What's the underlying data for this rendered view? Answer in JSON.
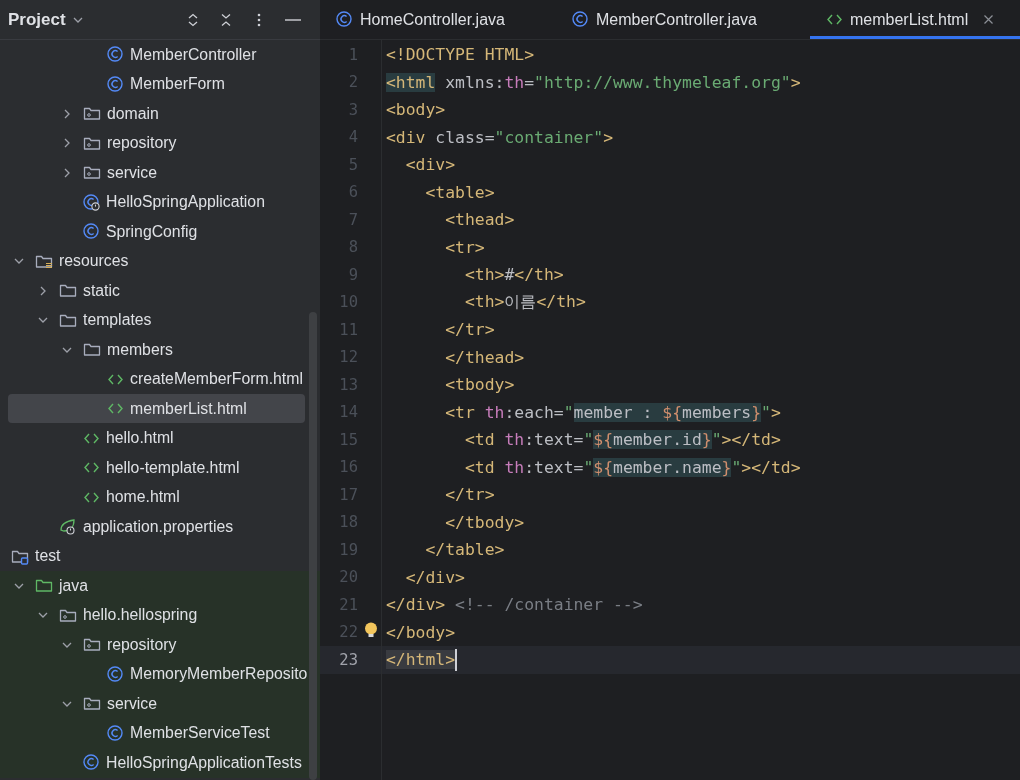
{
  "sidebar": {
    "title": "Project",
    "tree": [
      {
        "kind": "hidden",
        "children": [
          {
            "kind": "hidden",
            "children": [
              {
                "kind": "hidden",
                "children": [
                  {
                    "kind": "hidden",
                    "children": [
                      {
                        "kind": "class",
                        "label": "MemberController",
                        "selected": false
                      },
                      {
                        "kind": "class",
                        "label": "MemberForm",
                        "selected": false
                      }
                    ]
                  },
                  {
                    "kind": "package",
                    "label": "domain",
                    "expanded": false,
                    "selected": false
                  },
                  {
                    "kind": "package",
                    "label": "repository",
                    "expanded": false,
                    "selected": false
                  },
                  {
                    "kind": "package",
                    "label": "service",
                    "expanded": false,
                    "selected": false
                  },
                  {
                    "kind": "spring-app",
                    "label": "HelloSpringApplication",
                    "selected": false
                  },
                  {
                    "kind": "class",
                    "label": "SpringConfig",
                    "selected": false
                  }
                ]
              }
            ]
          },
          {
            "kind": "resources-folder",
            "label": "resources",
            "expanded": true,
            "selected": false,
            "children": [
              {
                "kind": "folder",
                "label": "static",
                "expanded": false,
                "selected": false
              },
              {
                "kind": "folder",
                "label": "templates",
                "expanded": true,
                "selected": false,
                "children": [
                  {
                    "kind": "folder",
                    "label": "members",
                    "expanded": true,
                    "selected": false,
                    "children": [
                      {
                        "kind": "html",
                        "label": "createMemberForm.html",
                        "selected": false
                      },
                      {
                        "kind": "html",
                        "label": "memberList.html",
                        "selected": true
                      }
                    ]
                  },
                  {
                    "kind": "html",
                    "label": "hello.html",
                    "selected": false
                  },
                  {
                    "kind": "html",
                    "label": "hello-template.html",
                    "selected": false
                  },
                  {
                    "kind": "html",
                    "label": "home.html",
                    "selected": false
                  }
                ]
              },
              {
                "kind": "properties",
                "label": "application.properties",
                "selected": false
              }
            ]
          }
        ]
      },
      {
        "kind": "test-folder",
        "label": "test",
        "selected": false,
        "children": [
          {
            "kind": "test-source-folder",
            "label": "java",
            "expanded": true,
            "selected": false,
            "children": [
              {
                "kind": "package",
                "label": "hello.hellospring",
                "expanded": true,
                "selected": false,
                "children": [
                  {
                    "kind": "package",
                    "label": "repository",
                    "expanded": true,
                    "selected": false,
                    "children": [
                      {
                        "kind": "class",
                        "label": "MemoryMemberReposito",
                        "selected": false
                      }
                    ]
                  },
                  {
                    "kind": "package",
                    "label": "service",
                    "expanded": true,
                    "selected": false,
                    "children": [
                      {
                        "kind": "class",
                        "label": "MemberServiceTest",
                        "selected": false
                      }
                    ]
                  },
                  {
                    "kind": "class",
                    "label": "HelloSpringApplicationTests",
                    "selected": false
                  }
                ]
              }
            ]
          }
        ]
      }
    ]
  },
  "tabs": [
    {
      "kind": "class",
      "label": "HomeController.java",
      "selected": false
    },
    {
      "kind": "class",
      "label": "MemberController.java",
      "selected": false
    },
    {
      "kind": "html",
      "label": "memberList.html",
      "selected": true
    }
  ],
  "code": {
    "lines": [
      {
        "number": "1",
        "current": false,
        "bulb": false,
        "tokens": [
          {
            "kind": "tag",
            "text": "<!DOCTYPE HTML>"
          }
        ]
      },
      {
        "number": "2",
        "current": false,
        "bulb": false,
        "tokens": [
          {
            "kind": "match",
            "tokens": [
              {
                "kind": "tag",
                "text": "<html"
              }
            ]
          },
          {
            "kind": "text",
            "text": " xmlns:"
          },
          {
            "kind": "ns",
            "text": "th"
          },
          {
            "kind": "text",
            "text": "="
          },
          {
            "kind": "str",
            "text": "\"http://www.thymeleaf.org\""
          },
          {
            "kind": "tag",
            "text": ">"
          }
        ]
      },
      {
        "number": "3",
        "current": false,
        "bulb": false,
        "tokens": [
          {
            "kind": "tag",
            "text": "<body>"
          }
        ]
      },
      {
        "number": "4",
        "current": false,
        "bulb": false,
        "tokens": [
          {
            "kind": "tag",
            "text": "<div"
          },
          {
            "kind": "text",
            "text": " class="
          },
          {
            "kind": "str",
            "text": "\"container\""
          },
          {
            "kind": "tag",
            "text": ">"
          }
        ]
      },
      {
        "number": "5",
        "current": false,
        "bulb": false,
        "tokens": [
          {
            "kind": "tag",
            "text": "  <div>"
          }
        ]
      },
      {
        "number": "6",
        "current": false,
        "bulb": false,
        "tokens": [
          {
            "kind": "tag",
            "text": "    <table>"
          }
        ]
      },
      {
        "number": "7",
        "current": false,
        "bulb": false,
        "tokens": [
          {
            "kind": "tag",
            "text": "      <thead>"
          }
        ]
      },
      {
        "number": "8",
        "current": false,
        "bulb": false,
        "tokens": [
          {
            "kind": "tag",
            "text": "      <tr>"
          }
        ]
      },
      {
        "number": "9",
        "current": false,
        "bulb": false,
        "tokens": [
          {
            "kind": "tag",
            "text": "        <th>"
          },
          {
            "kind": "text",
            "text": "#"
          },
          {
            "kind": "tag",
            "text": "</th>"
          }
        ]
      },
      {
        "number": "10",
        "current": false,
        "bulb": false,
        "tokens": [
          {
            "kind": "tag",
            "text": "        <th>"
          },
          {
            "kind": "text",
            "text": "이름"
          },
          {
            "kind": "tag",
            "text": "</th>"
          }
        ]
      },
      {
        "number": "11",
        "current": false,
        "bulb": false,
        "tokens": [
          {
            "kind": "tag",
            "text": "      </tr>"
          }
        ]
      },
      {
        "number": "12",
        "current": false,
        "bulb": false,
        "tokens": [
          {
            "kind": "tag",
            "text": "      </thead>"
          }
        ]
      },
      {
        "number": "13",
        "current": false,
        "bulb": false,
        "tokens": [
          {
            "kind": "tag",
            "text": "      <tbody>"
          }
        ]
      },
      {
        "number": "14",
        "current": false,
        "bulb": false,
        "tokens": [
          {
            "kind": "tag",
            "text": "      <tr "
          },
          {
            "kind": "ns",
            "text": "th"
          },
          {
            "kind": "text",
            "text": ":each="
          },
          {
            "kind": "str",
            "text": "\""
          },
          {
            "kind": "match",
            "tokens": [
              {
                "kind": "text",
                "text": "member : "
              },
              {
                "kind": "expr",
                "text": "${"
              },
              {
                "kind": "text",
                "text": "members"
              },
              {
                "kind": "expr",
                "text": "}"
              }
            ]
          },
          {
            "kind": "str",
            "text": "\""
          },
          {
            "kind": "tag",
            "text": ">"
          }
        ]
      },
      {
        "number": "15",
        "current": false,
        "bulb": false,
        "tokens": [
          {
            "kind": "tag",
            "text": "        <td "
          },
          {
            "kind": "ns",
            "text": "th"
          },
          {
            "kind": "text",
            "text": ":text="
          },
          {
            "kind": "str",
            "text": "\""
          },
          {
            "kind": "match",
            "tokens": [
              {
                "kind": "expr",
                "text": "${"
              },
              {
                "kind": "text",
                "text": "member.id"
              },
              {
                "kind": "expr",
                "text": "}"
              }
            ]
          },
          {
            "kind": "str",
            "text": "\""
          },
          {
            "kind": "tag",
            "text": "></td>"
          }
        ]
      },
      {
        "number": "16",
        "current": false,
        "bulb": false,
        "tokens": [
          {
            "kind": "tag",
            "text": "        <td "
          },
          {
            "kind": "ns",
            "text": "th"
          },
          {
            "kind": "text",
            "text": ":text="
          },
          {
            "kind": "str",
            "text": "\""
          },
          {
            "kind": "match",
            "tokens": [
              {
                "kind": "expr",
                "text": "${"
              },
              {
                "kind": "text",
                "text": "member.name"
              },
              {
                "kind": "expr",
                "text": "}"
              }
            ]
          },
          {
            "kind": "str",
            "text": "\""
          },
          {
            "kind": "tag",
            "text": "></td>"
          }
        ]
      },
      {
        "number": "17",
        "current": false,
        "bulb": false,
        "tokens": [
          {
            "kind": "tag",
            "text": "      </tr>"
          }
        ]
      },
      {
        "number": "18",
        "current": false,
        "bulb": false,
        "tokens": [
          {
            "kind": "tag",
            "text": "      </tbody>"
          }
        ]
      },
      {
        "number": "19",
        "current": false,
        "bulb": false,
        "tokens": [
          {
            "kind": "tag",
            "text": "    </table>"
          }
        ]
      },
      {
        "number": "20",
        "current": false,
        "bulb": false,
        "tokens": [
          {
            "kind": "tag",
            "text": "  </div>"
          }
        ]
      },
      {
        "number": "21",
        "current": false,
        "bulb": false,
        "tokens": [
          {
            "kind": "tag",
            "text": "</div> "
          },
          {
            "kind": "comment",
            "text": "<!-- /container -->"
          }
        ]
      },
      {
        "number": "22",
        "current": false,
        "bulb": true,
        "tokens": [
          {
            "kind": "tag",
            "text": "</body>"
          }
        ]
      },
      {
        "number": "23",
        "current": true,
        "bulb": false,
        "tokens": [
          {
            "kind": "match",
            "tokens": [
              {
                "kind": "tag",
                "text": "</html>"
              }
            ]
          }
        ]
      }
    ]
  }
}
